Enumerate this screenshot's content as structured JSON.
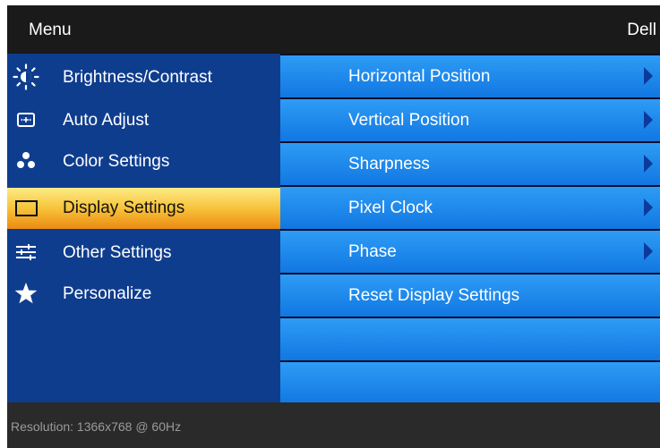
{
  "header": {
    "title": "Menu",
    "brand": "Dell"
  },
  "sidebar": {
    "items": [
      {
        "label": "Brightness/Contrast",
        "icon": "brightness-icon"
      },
      {
        "label": "Auto Adjust",
        "icon": "auto-adjust-icon"
      },
      {
        "label": "Color Settings",
        "icon": "color-settings-icon"
      },
      {
        "label": "Display Settings",
        "icon": "display-icon",
        "selected": true
      },
      {
        "label": "Other Settings",
        "icon": "sliders-icon"
      },
      {
        "label": "Personalize",
        "icon": "star-icon"
      }
    ]
  },
  "submenu": {
    "items": [
      {
        "label": "Horizontal Position",
        "has_arrow": true
      },
      {
        "label": "Vertical Position",
        "has_arrow": true
      },
      {
        "label": "Sharpness",
        "has_arrow": true
      },
      {
        "label": "Pixel Clock",
        "has_arrow": true
      },
      {
        "label": "Phase",
        "has_arrow": true
      },
      {
        "label": "Reset Display Settings",
        "has_arrow": false
      },
      {
        "label": ""
      },
      {
        "label": ""
      }
    ]
  },
  "footer": {
    "resolution": "Resolution: 1366x768 @ 60Hz"
  },
  "colors": {
    "sidebar_bg": "#0f3d8e",
    "submenu_bg": "#1a84ec",
    "selected_highlight": "#f7c33a",
    "arrow": "#0b3a9c"
  }
}
